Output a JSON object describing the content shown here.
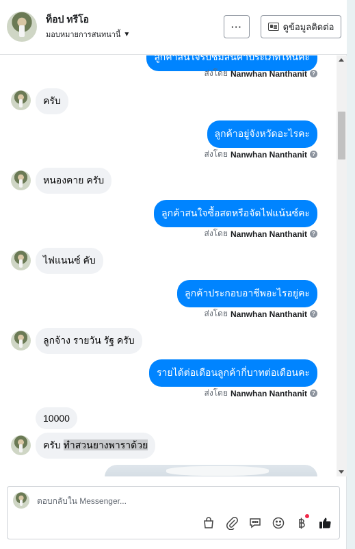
{
  "header": {
    "name": "ท็อป ทรีโอ",
    "subtitle": "มอบหมายการสนทนานี้",
    "more_label": "···",
    "contact_label": "ดูข้อมูลติดต่อ"
  },
  "messages": [
    {
      "dir": "out",
      "text": "ลูกค้าสนใจรับชมสินค้าประเภทไหนคะ",
      "sent_by_prefix": "ส่งโดย",
      "sender": "Nanwhan Nanthanit"
    },
    {
      "dir": "in",
      "text": "ครับ"
    },
    {
      "dir": "out",
      "text": "ลูกค้าอยู่จังหวัดอะไรคะ",
      "sent_by_prefix": "ส่งโดย",
      "sender": "Nanwhan Nanthanit"
    },
    {
      "dir": "in",
      "text": "หนองคาย ครับ"
    },
    {
      "dir": "out",
      "text": "ลูกค้าสนใจซื้อสดหรือจัดไฟแน้นซ์คะ",
      "sent_by_prefix": "ส่งโดย",
      "sender": "Nanwhan Nanthanit"
    },
    {
      "dir": "in",
      "text": "ไฟแนนซ์ คับ"
    },
    {
      "dir": "out",
      "text": "ลูกค้าประกอบอาชีพอะไรอยู่คะ",
      "sent_by_prefix": "ส่งโดย",
      "sender": "Nanwhan Nanthanit"
    },
    {
      "dir": "in",
      "text": "ลูกจ้าง รายวัน รัฐ ครับ"
    },
    {
      "dir": "out",
      "text": "รายได้ต่อเดือนลูกค้ากี่บาทต่อเดือนคะ",
      "sent_by_prefix": "ส่งโดย",
      "sender": "Nanwhan Nanthanit"
    },
    {
      "dir": "in",
      "text": "10000"
    },
    {
      "dir": "in",
      "text_plain": "ครับ ",
      "text_highlight": "ทำสวนยางพาราด้วย"
    }
  ],
  "composer": {
    "placeholder": "ตอบกลับใน Messenger..."
  },
  "icons": {
    "bag": "shopping-bag-icon",
    "attach": "paperclip-icon",
    "saved_replies": "chat-bubble-icon",
    "emoji": "smiley-icon",
    "payment": "baht-icon",
    "like": "thumbs-up-icon"
  },
  "colors": {
    "outgoing_bubble": "#0084ff",
    "incoming_bubble": "#f0f2f5",
    "notification_dot": "#f02849",
    "like_icon": "#1c1e21"
  }
}
